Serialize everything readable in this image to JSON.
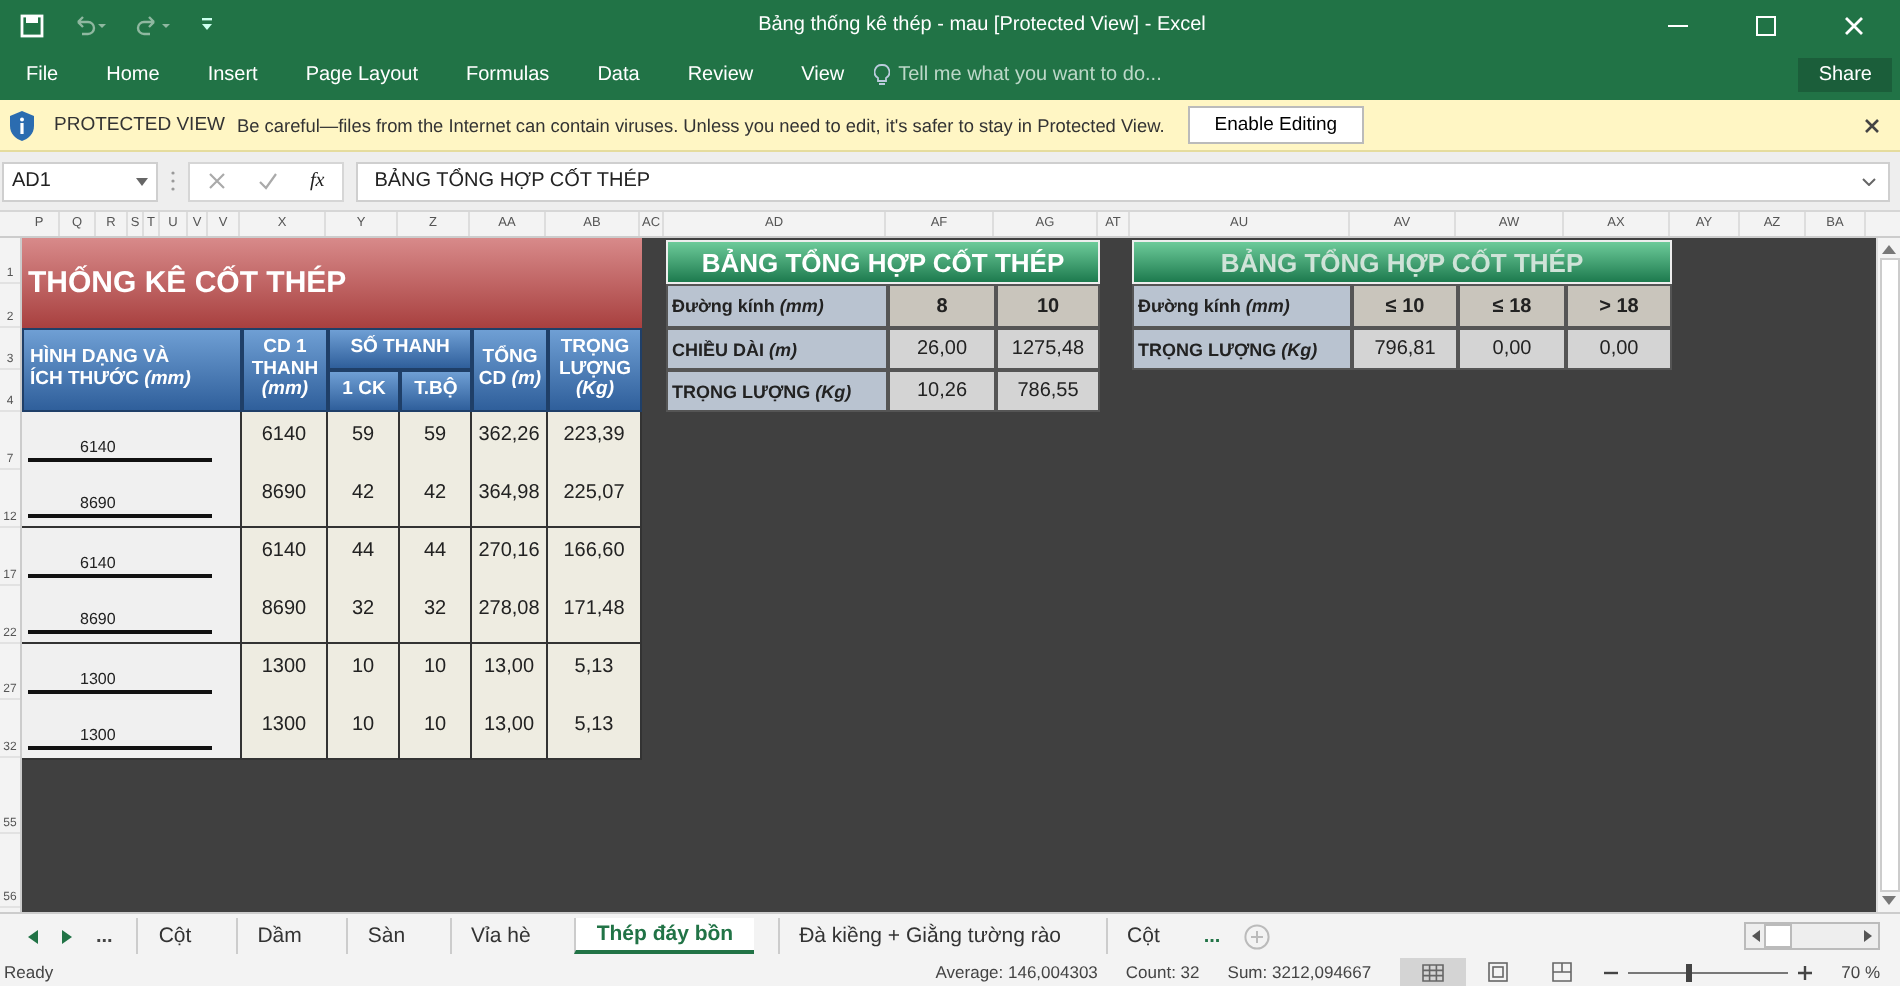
{
  "window": {
    "title": "Bảng thống kê thép - mau  [Protected View] - Excel"
  },
  "ribbon": {
    "tabs": [
      {
        "label": "File",
        "selected": false
      },
      {
        "label": "Home",
        "selected": false
      },
      {
        "label": "Insert",
        "selected": false
      },
      {
        "label": "Page Layout",
        "selected": false
      },
      {
        "label": "Formulas",
        "selected": false
      },
      {
        "label": "Data",
        "selected": false
      },
      {
        "label": "Review",
        "selected": false
      },
      {
        "label": "View",
        "selected": false
      }
    ],
    "tell_me": "Tell me what you want to do...",
    "share": "Share"
  },
  "protected_view": {
    "label": "PROTECTED VIEW",
    "message": "Be careful—files from the Internet can contain viruses. Unless you need to edit, it's safer to stay in Protected View.",
    "button": "Enable Editing"
  },
  "formula_bar": {
    "name_box": "AD1",
    "function_label": "fx",
    "formula": "BẢNG TỔNG HỢP CỐT THÉP"
  },
  "column_headers": [
    "P",
    "Q",
    "R",
    "S",
    "T",
    "U",
    "V",
    "V",
    "X",
    "Y",
    "Z",
    "AA",
    "AB",
    "AC",
    "AD",
    "AF",
    "AG",
    "AT",
    "AU",
    "AV",
    "AW",
    "AX",
    "AY",
    "AZ",
    "BA"
  ],
  "row_headers": [
    "1",
    "2",
    "3",
    "4",
    "7",
    "12",
    "17",
    "22",
    "27",
    "32",
    "55",
    "56"
  ],
  "steel_table": {
    "title": "THỐNG KÊ CỐT THÉP",
    "headers": {
      "shape_line_1": "HÌNH DẠNG VÀ",
      "shape_line_2": "ÍCH THƯỚC *(mm)*",
      "cd1": "CD 1 THANH *(mm)*",
      "count": "SỐ THANH",
      "per_ck": "1 CK",
      "total_count": "T.BỘ",
      "total_length": "TỔNG CD *(m)*",
      "weight": "TRỌNG LƯỢNG *(Kg)*"
    },
    "rows": [
      {
        "shape_label": "6140",
        "cd1": "6140",
        "per_ck": "59",
        "total_count": "59",
        "total_length": "362,26",
        "weight": "223,39"
      },
      {
        "shape_label": "8690",
        "cd1": "8690",
        "per_ck": "42",
        "total_count": "42",
        "total_length": "364,98",
        "weight": "225,07"
      },
      {
        "shape_label": "6140",
        "cd1": "6140",
        "per_ck": "44",
        "total_count": "44",
        "total_length": "270,16",
        "weight": "166,60"
      },
      {
        "shape_label": "8690",
        "cd1": "8690",
        "per_ck": "32",
        "total_count": "32",
        "total_length": "278,08",
        "weight": "171,48"
      },
      {
        "shape_label": "1300",
        "cd1": "1300",
        "per_ck": "10",
        "total_count": "10",
        "total_length": "13,00",
        "weight": "5,13"
      },
      {
        "shape_label": "1300",
        "cd1": "1300",
        "per_ck": "10",
        "total_count": "10",
        "total_length": "13,00",
        "weight": "5,13"
      }
    ]
  },
  "diameter_summary": {
    "title": "BẢNG TỔNG HỢP CỐT THÉP",
    "header": {
      "label": "Đường kính *(mm)*",
      "values": [
        "8",
        "10"
      ]
    },
    "rows": [
      {
        "label": "CHIỀU DÀI *(m)*",
        "values": [
          "26,00",
          "1275,48"
        ]
      },
      {
        "label": "TRỌNG LƯỢNG *(Kg)*",
        "values": [
          "10,26",
          "786,55"
        ]
      }
    ]
  },
  "weight_summary": {
    "title": "BẢNG TỔNG HỢP CỐT THÉP",
    "header": {
      "label": "Đường kính *(mm)*",
      "values": [
        "≤ 10",
        "≤ 18",
        "> 18"
      ]
    },
    "rows": [
      {
        "label": "TRỌNG LƯỢNG *(Kg)*",
        "values": [
          "796,81",
          "0,00",
          "0,00"
        ]
      }
    ]
  },
  "sheet_tabs": {
    "overflow_left": "...",
    "tabs": [
      {
        "label": "Cột",
        "selected": false
      },
      {
        "label": "Dầm",
        "selected": false
      },
      {
        "label": "Sàn",
        "selected": false
      },
      {
        "label": "Vỉa hè",
        "selected": false
      },
      {
        "label": "Thép đáy bồn",
        "selected": true
      },
      {
        "label": "Đà kiềng + Giằng tường rào",
        "selected": false
      },
      {
        "label": "Cột",
        "selected": false
      }
    ],
    "overflow_right": "..."
  },
  "status_bar": {
    "status": "Ready",
    "average": "Average: 146,004303",
    "count": "Count: 32",
    "sum": "Sum: 3212,094667",
    "views": [
      {
        "kind": "normal",
        "selected": true
      },
      {
        "kind": "page_layout",
        "selected": false
      },
      {
        "kind": "page_break",
        "selected": false
      }
    ],
    "zoom": {
      "level": 0.38,
      "label": "70 %"
    }
  }
}
